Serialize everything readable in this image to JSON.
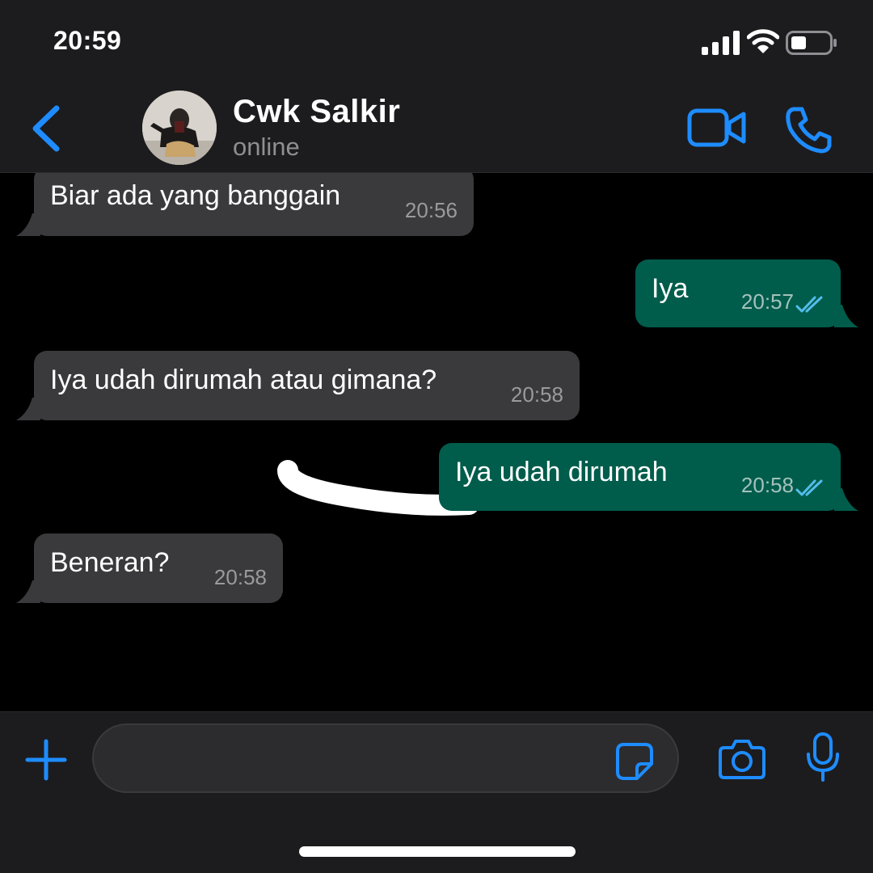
{
  "status_bar": {
    "time": "20:59"
  },
  "header": {
    "contact_name": "Cwk Salkir",
    "contact_status": "online"
  },
  "messages": [
    {
      "direction": "in",
      "text": "Biar ada yang banggain",
      "time": "20:56"
    },
    {
      "direction": "out",
      "text": "Iya",
      "time": "20:57",
      "read": true
    },
    {
      "direction": "in",
      "text": "Iya udah dirumah atau gimana?",
      "time": "20:58"
    },
    {
      "direction": "out",
      "text": "Iya udah dirumah",
      "time": "20:58",
      "read": true
    },
    {
      "direction": "in",
      "text": "Beneran?",
      "time": "20:58"
    }
  ],
  "composer": {
    "value": "",
    "placeholder": ""
  },
  "colors": {
    "accent": "#1e8cff",
    "incoming_bubble": "#3a3a3c",
    "outgoing_bubble": "#005c4b",
    "read_ticks": "#53bdeb"
  },
  "icons": [
    "back-chevron-icon",
    "video-call-icon",
    "phone-icon",
    "plus-icon",
    "sticker-icon",
    "camera-icon",
    "microphone-icon",
    "double-check-icon"
  ]
}
